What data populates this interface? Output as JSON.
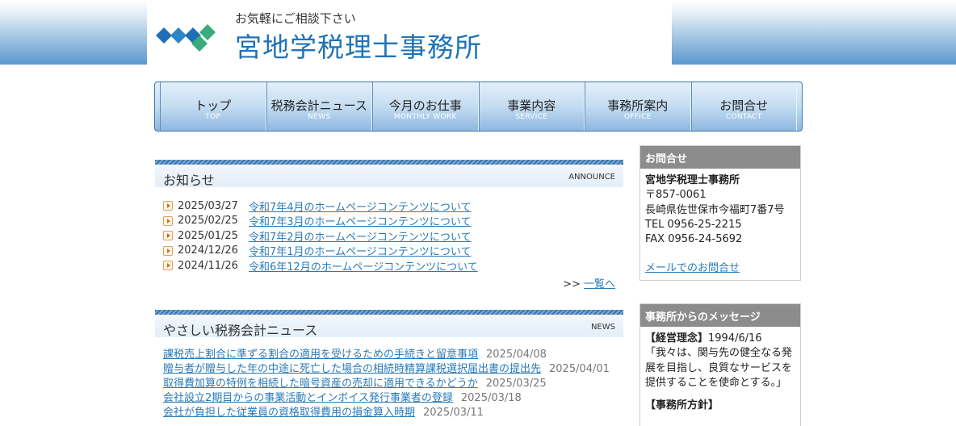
{
  "header": {
    "tagline": "お気軽にご相談下さい",
    "title": "宮地学税理士事務所",
    "logo_icon": "logo-mark-icon"
  },
  "nav": [
    {
      "label": "トップ",
      "sub": "TOP"
    },
    {
      "label": "税務会計ニュース",
      "sub": "NEWS"
    },
    {
      "label": "今月のお仕事",
      "sub": "MONTHLY WORK"
    },
    {
      "label": "事業内容",
      "sub": "SERVICE"
    },
    {
      "label": "事務所案内",
      "sub": "OFFICE"
    },
    {
      "label": "お問合せ",
      "sub": "CONTACT"
    }
  ],
  "announce": {
    "title": "お知らせ",
    "tag": "ANNOUNCE",
    "items": [
      {
        "date": "2025/03/27",
        "text": "令和7年4月のホームページコンテンツについて"
      },
      {
        "date": "2025/02/25",
        "text": "令和7年3月のホームページコンテンツについて"
      },
      {
        "date": "2025/01/25",
        "text": "令和7年2月のホームページコンテンツについて"
      },
      {
        "date": "2024/12/26",
        "text": "令和7年1月のホームページコンテンツについて"
      },
      {
        "date": "2024/11/26",
        "text": "令和6年12月のホームページコンテンツについて"
      }
    ],
    "more_prefix": ">> ",
    "more_label": "一覧へ"
  },
  "tax_news": {
    "title": "やさしい税務会計ニュース",
    "tag": "NEWS",
    "items": [
      {
        "text": "課税売上割合に準ずる割合の適用を受けるための手続きと留意事項",
        "date": "2025/04/08"
      },
      {
        "text": "贈与者が贈与した年の中途に死亡した場合の相続時精算課税選択届出書の提出先",
        "date": "2025/04/01"
      },
      {
        "text": "取得費加算の特例を相続した暗号資産の売却に適用できるかどうか",
        "date": "2025/03/25"
      },
      {
        "text": "会社設立2期目からの事業活動とインボイス発行事業者の登録",
        "date": "2025/03/18"
      },
      {
        "text": "会社が負担した従業員の資格取得費用の損金算入時期",
        "date": "2025/03/11"
      }
    ]
  },
  "contact": {
    "heading": "お問合せ",
    "name": "宮地学税理士事務所",
    "zip": "〒857-0061",
    "address": "長崎県佐世保市今福町7番7号",
    "tel": "TEL 0956-25-2215",
    "fax": "FAX 0956-24-5692",
    "mail_label": "メールでのお問合せ"
  },
  "message": {
    "heading": "事務所からのメッセージ",
    "label1": "【経営理念】",
    "date1": "1994/6/16",
    "text1": "「我々は、関与先の健全なる発展を目指し、良質なサービスを提供することを使命とする。」",
    "label2": "【事務所方針】"
  }
}
